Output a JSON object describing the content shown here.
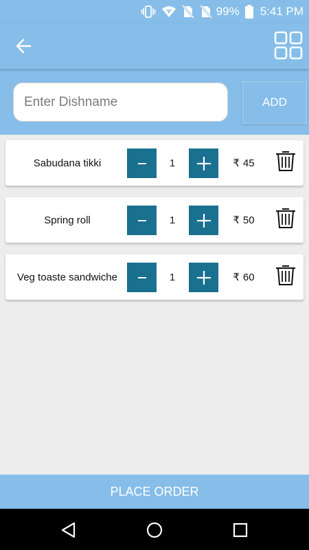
{
  "status_bar": {
    "icons": [
      "vibrate-icon",
      "wifi-icon",
      "no-sim-icon",
      "no-sim-icon",
      "battery-icon"
    ],
    "battery_percent": "99%",
    "time": "5:41 PM"
  },
  "app_bar": {
    "back_icon": "arrow-left-icon",
    "menu_icon": "grid-view-icon"
  },
  "search": {
    "placeholder": "Enter Dishname",
    "value": "",
    "add_label": "ADD"
  },
  "items": [
    {
      "name": "Sabudana tikki",
      "qty": "1",
      "currency": "₹",
      "price": "45"
    },
    {
      "name": "Spring roll",
      "qty": "1",
      "currency": "₹",
      "price": "50"
    },
    {
      "name": "Veg toaste sandwiche",
      "qty": "1",
      "currency": "₹",
      "price": "60"
    }
  ],
  "footer": {
    "place_order_label": "PLACE ORDER"
  },
  "colors": {
    "primary": "#86bee9",
    "accent": "#19708f",
    "background": "#ededed"
  },
  "nav_bar": {
    "icons": [
      "back-triangle-icon",
      "home-circle-icon",
      "recents-square-icon"
    ]
  }
}
